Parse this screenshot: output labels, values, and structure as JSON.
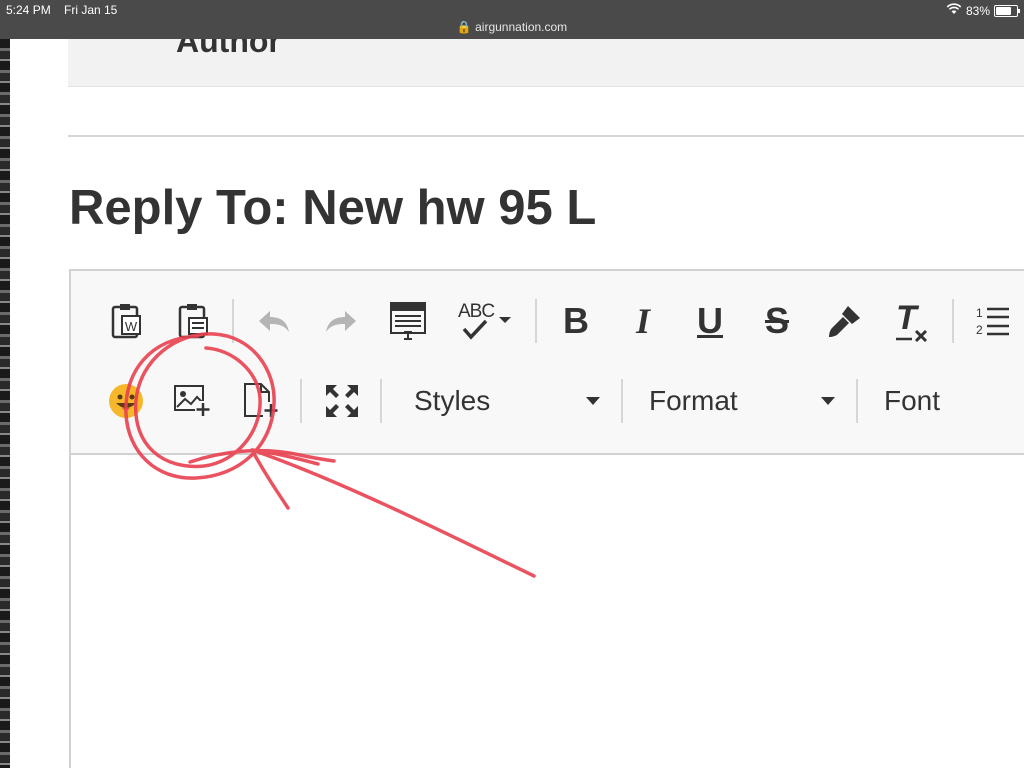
{
  "status_bar": {
    "time": "5:24 PM",
    "date": "Fri Jan 15",
    "url": "airgunnation.com",
    "battery": "83%",
    "battery_level": 0.83
  },
  "author_label": "Author",
  "reply_title": "Reply To: New hw 95 L",
  "toolbar": {
    "row1": [
      {
        "name": "paste-from-word-icon"
      },
      {
        "name": "paste-as-text-icon"
      },
      {
        "name": "undo-icon"
      },
      {
        "name": "redo-icon"
      },
      {
        "name": "templates-icon"
      },
      {
        "name": "spellcheck-icon",
        "text": "ABC"
      },
      {
        "name": "bold-icon",
        "text": "B"
      },
      {
        "name": "italic-icon",
        "text": "I"
      },
      {
        "name": "underline-icon",
        "text": "U"
      },
      {
        "name": "strikethrough-icon",
        "text": "S"
      },
      {
        "name": "copy-formatting-icon"
      },
      {
        "name": "remove-format-icon",
        "text": "T"
      },
      {
        "name": "numbered-list-icon"
      }
    ],
    "row2": [
      {
        "name": "emoji-icon"
      },
      {
        "name": "insert-image-icon"
      },
      {
        "name": "insert-file-icon"
      },
      {
        "name": "maximize-icon"
      }
    ],
    "styles_label": "Styles",
    "format_label": "Format",
    "font_label": "Font"
  },
  "colors": {
    "annotation": "#e8404f",
    "heading": "#333333",
    "statusbar": "#4a4a4a"
  }
}
